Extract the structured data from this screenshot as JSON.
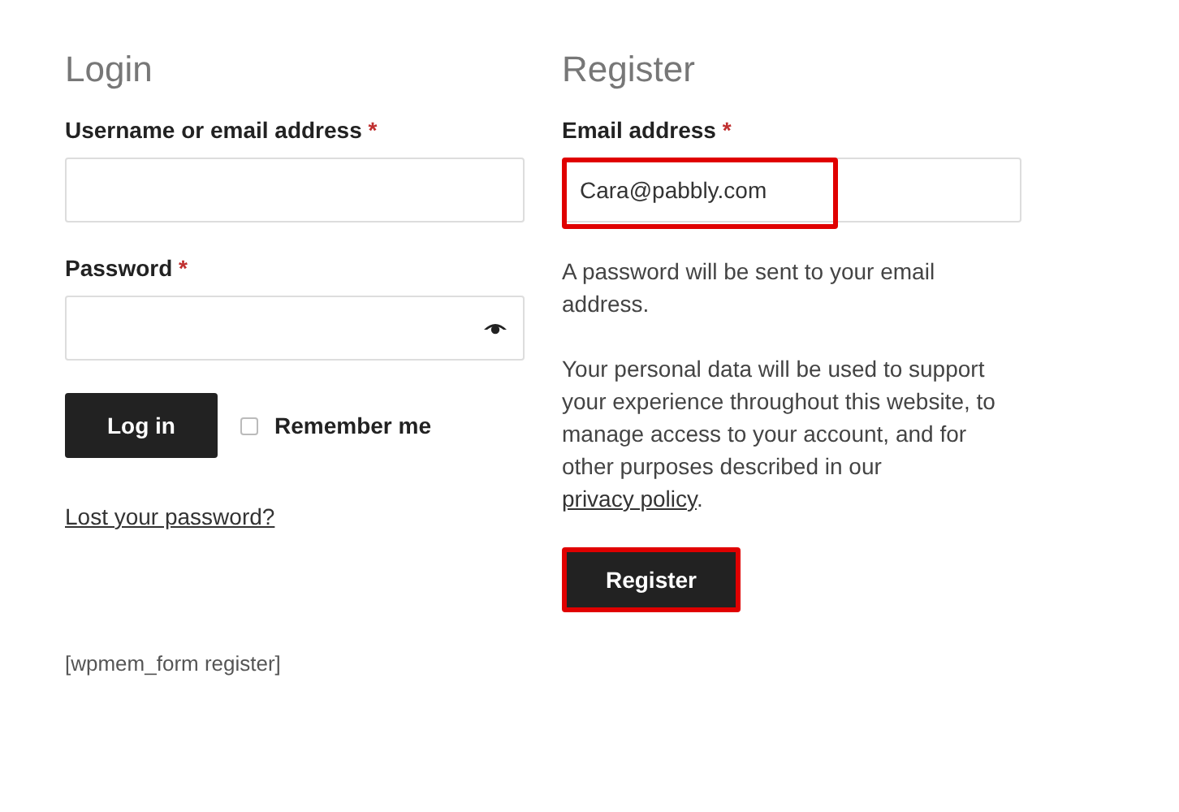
{
  "login": {
    "heading": "Login",
    "username": {
      "label": "Username or email address",
      "required": "*"
    },
    "password": {
      "label": "Password",
      "required": "*"
    },
    "button": "Log in",
    "remember": {
      "label": "Remember me",
      "checked": false
    },
    "lost_password": "Lost your password?"
  },
  "register": {
    "heading": "Register",
    "email": {
      "label": "Email address",
      "required": "*",
      "value": "Cara@pabbly.com",
      "highlighted": true
    },
    "note": "A password will be sent to your email address.",
    "privacy_text": "Your personal data will be used to support your experience throughout this website, to manage access to your account, and for other purposes described in our",
    "privacy_link": "privacy policy",
    "privacy_end": ".",
    "button": "Register",
    "button_highlighted": true
  },
  "shortcode": "[wpmem_form register]"
}
